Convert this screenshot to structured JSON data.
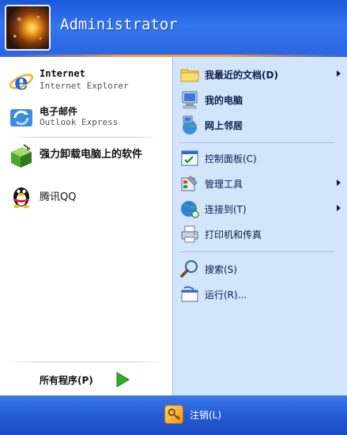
{
  "user": {
    "name": "Administrator"
  },
  "left": {
    "pinned": [
      {
        "title": "Internet",
        "subtitle": "Internet Explorer",
        "icon": "internet-explorer-icon"
      },
      {
        "title": "电子邮件",
        "subtitle": "Outlook Express",
        "icon": "outlook-express-icon"
      }
    ],
    "recent": [
      {
        "label": "强力卸载电脑上的软件",
        "icon": "uninstaller-icon"
      },
      {
        "label": "腾讯QQ",
        "icon": "qq-penguin-icon"
      }
    ],
    "all_programs": "所有程序(P)"
  },
  "right": {
    "items": [
      {
        "label": "我最近的文档(D)",
        "icon": "recent-documents-folder-icon",
        "submenu": true
      },
      {
        "label": "我的电脑",
        "icon": "my-computer-icon",
        "submenu": false
      },
      {
        "label": "网上邻居",
        "icon": "network-places-icon",
        "submenu": false
      },
      {
        "label": "控制面板(C)",
        "icon": "control-panel-icon",
        "submenu": false
      },
      {
        "label": "管理工具",
        "icon": "admin-tools-icon",
        "submenu": true
      },
      {
        "label": "连接到(T)",
        "icon": "connect-to-icon",
        "submenu": true
      },
      {
        "label": "打印机和传真",
        "icon": "printer-icon",
        "submenu": false
      },
      {
        "label": "搜索(S)",
        "icon": "search-icon",
        "submenu": false
      },
      {
        "label": "运行(R)...",
        "icon": "run-icon",
        "submenu": false
      }
    ]
  },
  "footer": {
    "logoff": "注销(L)"
  },
  "colors": {
    "header": "#2a64e0",
    "right_panel": "#d3e5fa",
    "accent": "#f59a3a"
  }
}
